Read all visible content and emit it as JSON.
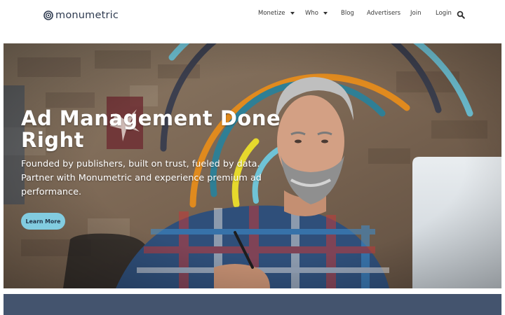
{
  "brand": {
    "name": "monumetric"
  },
  "nav": {
    "items": [
      {
        "label": "Monetize",
        "dropdown": true
      },
      {
        "label": "Who",
        "dropdown": true
      },
      {
        "label": "Blog",
        "dropdown": false
      },
      {
        "label": "Advertisers",
        "dropdown": false
      },
      {
        "label": "Join",
        "dropdown": false
      },
      {
        "label": "Login",
        "dropdown": false
      }
    ],
    "search_icon": "search-icon"
  },
  "hero": {
    "title": "Ad Management Done Right",
    "subtitle": "Founded by publishers, built on trust, fueled by data. Partner with Monumetric and experience premium ad performance.",
    "button_label": "Learn More"
  },
  "colors": {
    "brand_dark": "#2f3b50",
    "button_bg": "#82cce0",
    "footer_band": "#44546e",
    "arc_orange": "#e08a1e",
    "arc_teal": "#2f7f95",
    "arc_light_blue": "#6fc3d6",
    "arc_dark": "#3c3f4e",
    "arc_yellow": "#e6d92c"
  }
}
